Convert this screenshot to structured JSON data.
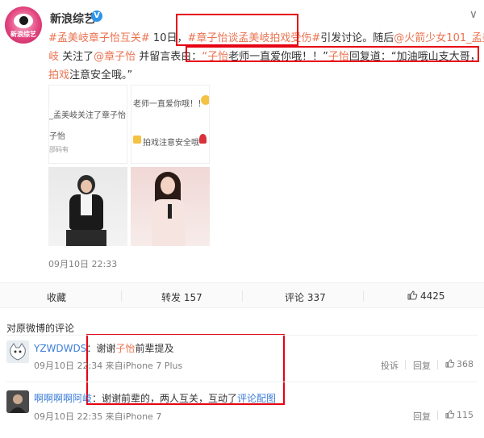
{
  "post": {
    "author": "新浪综艺",
    "verified_mark": "V",
    "more_mark": "∨",
    "avatar_text": "新浪综艺",
    "line1": {
      "hashtag1": "#孟美岐章子怡互关#",
      "text1": " 10日，",
      "hashtag2": "#章子怡谈孟美岐拍戏受伤#",
      "text2": "引发讨论。随后",
      "mention1": "@火箭少女101_孟美"
    },
    "line2": {
      "mention1_end": "岐",
      "text1": " 关注了",
      "mention2": "@章子怡",
      "text2": " 并留言表白：",
      "quote1_open": "“",
      "quote1_name": "子怡",
      "quote1_text": "老师一直爱你哦！！”",
      "quote2_name": "子怡",
      "quote2_text": "回复道：“加油哦山支大哥，"
    },
    "line3": {
      "hl": "拍戏",
      "text": "注意安全哦。”"
    },
    "images": {
      "img1_lines": [
        "_孟美岐关注了章子怡",
        "子怡",
        "邵码有"
      ],
      "img2_lines": [
        "老师一直爱你哦！！",
        "拍戏注意安全哦"
      ]
    },
    "time": "09月10日 22:33"
  },
  "actions": {
    "favorite": "收藏",
    "repost": "转发 157",
    "comment": "评论 337",
    "like": "4425"
  },
  "comments_title": "对原微博的评论",
  "comments": [
    {
      "name": "YZWDWDS",
      "colon": "：",
      "text_pre": "谢谢",
      "text_hl": "子怡",
      "text_post": "前辈提及",
      "meta": "09月10日 22:34 来自iPhone 7 Plus",
      "report": "投诉",
      "reply": "回复",
      "likes": "368"
    },
    {
      "name": "啊啊啊啊阿岐",
      "colon": "：",
      "text": "谢谢前辈的，两人互关，互动了",
      "link": "评论配图",
      "meta": "09月10日 22:35 来自iPhone 7",
      "reply": "回复",
      "likes": "115"
    }
  ]
}
